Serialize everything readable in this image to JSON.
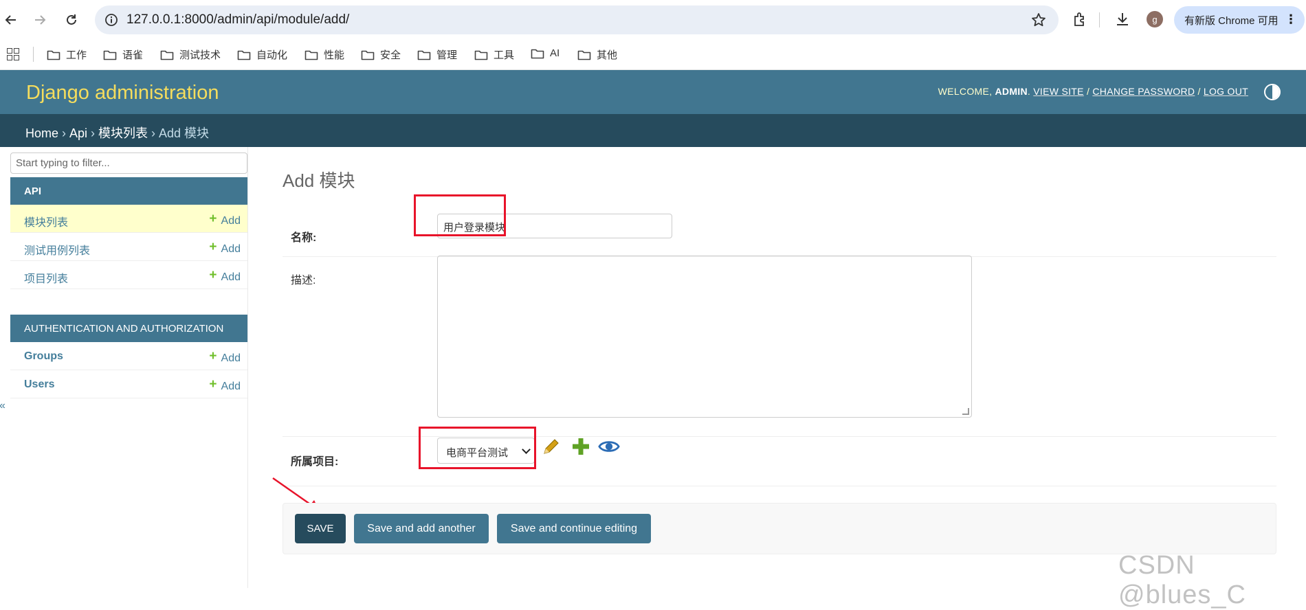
{
  "browser": {
    "url": "127.0.0.1:8000/admin/api/module/add/",
    "profile_initial": "g",
    "update_label": "有新版 Chrome 可用",
    "bookmarks": [
      "工作",
      "语雀",
      "测试技术",
      "自动化",
      "性能",
      "安全",
      "管理",
      "工具",
      "AI",
      "其他"
    ]
  },
  "header": {
    "brand": "Django administration",
    "welcome": "Welcome,",
    "user": "admin",
    "view_site": "View site",
    "change_password": "Change password",
    "log_out": "Log out"
  },
  "breadcrumbs": {
    "home": "Home",
    "app": "Api",
    "model": "模块列表",
    "current": "Add 模块"
  },
  "sidebar": {
    "filter_placeholder": "Start typing to filter...",
    "add_label": "Add",
    "collapse_glyph": "«",
    "apps": [
      {
        "caption": "API",
        "models": [
          "模块列表",
          "测试用例列表",
          "项目列表"
        ]
      },
      {
        "caption": "Authentication and Authorization",
        "models": [
          "Groups",
          "Users"
        ]
      }
    ]
  },
  "form": {
    "title": "Add 模块",
    "name_label": "名称:",
    "name_value": "用户登录模块",
    "desc_label": "描述:",
    "project_label": "所属项目:",
    "project_selected": "电商平台测试"
  },
  "buttons": {
    "save": "Save",
    "save_add_another": "Save and add another",
    "save_continue": "Save and continue editing"
  },
  "colors": {
    "header_bg": "#417690",
    "breadcrumb_bg": "#264b5d",
    "brand": "#f5dd5d",
    "highlight_box": "#e8132a",
    "link": "#447e9b",
    "add_plus": "#70bf2b"
  },
  "watermark": "CSDN @blues_C"
}
